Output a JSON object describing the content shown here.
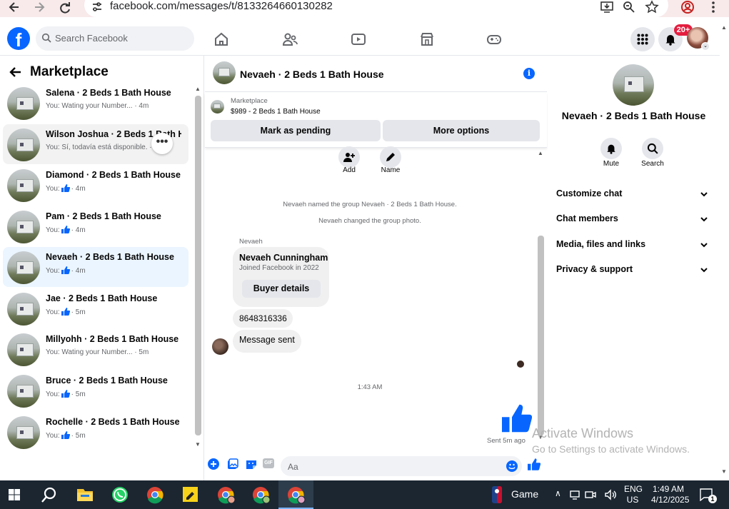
{
  "browser": {
    "url": "facebook.com/messages/t/8133264660130282",
    "icons": [
      "back-arrow-icon",
      "forward-arrow-icon",
      "reload-icon",
      "site-settings-icon",
      "install-app-icon",
      "zoom-icon",
      "star-icon",
      "profile-icon",
      "menu-dots-icon"
    ]
  },
  "fb": {
    "logo_letter": "f",
    "search_placeholder": "Search Facebook",
    "nav_icons": [
      "home-icon",
      "friends-icon",
      "video-icon",
      "marketplace-icon",
      "gaming-icon"
    ],
    "notification_badge": "20+"
  },
  "left": {
    "title": "Marketplace",
    "conversations": [
      {
        "name": "Salena · 2 Beds 1 Bath House",
        "preview": "You: Wating your Number... · 4m",
        "like": false
      },
      {
        "name": "Wilson Joshua · 2 Beds 1 Bath H...",
        "preview": "You: Sí, todavía está disponible. · 4m",
        "like": false
      },
      {
        "name": "Diamond · 2 Beds 1 Bath House",
        "preview_prefix": "You:",
        "preview_suffix": "· 4m",
        "like": true
      },
      {
        "name": "Pam · 2 Beds 1 Bath House",
        "preview_prefix": "You:",
        "preview_suffix": "· 4m",
        "like": true
      },
      {
        "name": "Nevaeh · 2 Beds 1 Bath House",
        "preview_prefix": "You:",
        "preview_suffix": "· 4m",
        "like": true
      },
      {
        "name": "Jae · 2 Beds 1 Bath House",
        "preview_prefix": "You:",
        "preview_suffix": "· 5m",
        "like": true
      },
      {
        "name": "Millyohh · 2 Beds 1 Bath House",
        "preview": "You: Wating your Number... · 5m",
        "like": false
      },
      {
        "name": "Bruce · 2 Beds 1 Bath House",
        "preview_prefix": "You:",
        "preview_suffix": "· 5m",
        "like": true
      },
      {
        "name": "Rochelle · 2 Beds 1 Bath House",
        "preview_prefix": "You:",
        "preview_suffix": "· 5m",
        "like": true
      }
    ],
    "more_button": "•••"
  },
  "chat": {
    "title": "Nevaeh · 2 Beds 1 Bath House",
    "info_icon": "i",
    "marketplace_label": "Marketplace",
    "listing": "$989 - 2 Beds 1 Bath House",
    "mark_pending": "Mark as pending",
    "more_options": "More options",
    "add_label": "Add",
    "name_label": "Name",
    "system1": "Nevaeh named the group Nevaeh · 2 Beds 1 Bath House.",
    "system2": "Nevaeh changed the group photo.",
    "sender": "Nevaeh",
    "card_name": "Nevaeh Cunningham",
    "card_sub": "Joined Facebook in 2022",
    "buyer_details": "Buyer details",
    "phone_msg": "8648316336",
    "sent_msg": "Message sent",
    "time": "1:43 AM",
    "sent_status": "Sent 5m ago",
    "composer_placeholder": "Aa",
    "composer_icons": [
      "plus-icon",
      "photo-icon",
      "sticker-icon",
      "gif-icon",
      "emoji-icon",
      "like-icon"
    ],
    "gif_text": "GIF"
  },
  "right": {
    "name": "Nevaeh · 2 Beds 1 Bath House",
    "mute": "Mute",
    "search": "Search",
    "rows": [
      "Customize chat",
      "Chat members",
      "Media, files and links",
      "Privacy & support"
    ]
  },
  "watermark": {
    "line1": "Activate Windows",
    "line2": "Go to Settings to activate Windows."
  },
  "taskbar": {
    "game": "Game",
    "lang1": "ENG",
    "lang2": "US",
    "time": "1:49 AM",
    "date": "4/12/2025",
    "notif_count": "1"
  },
  "colors": {
    "fb_blue": "#0866ff",
    "badge_red": "#e41e3f",
    "selected_bg": "#ebf5ff",
    "taskbar": "#1b2631"
  }
}
